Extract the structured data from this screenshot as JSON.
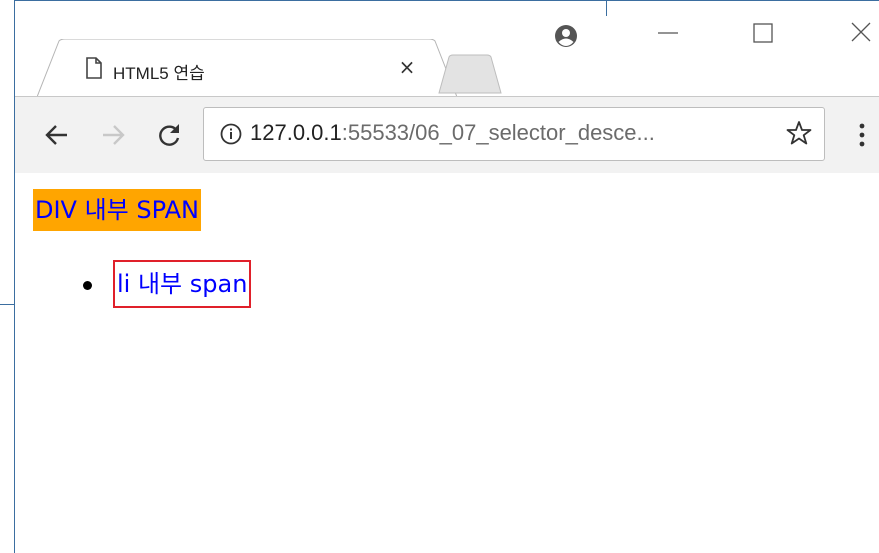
{
  "tab": {
    "title": "HTML5 연습",
    "close_label": "×",
    "page_icon": "page-icon"
  },
  "window_controls": {
    "profile": "profile-icon",
    "minimize": "minimize-icon",
    "maximize": "maximize-icon",
    "close": "close-icon"
  },
  "toolbar": {
    "back": "back-arrow-icon",
    "forward": "forward-arrow-icon",
    "reload": "reload-icon",
    "url_host": "127.0.0.1",
    "url_rest": ":55533/06_07_selector_desce...",
    "bookmark": "star-icon",
    "menu": "more-menu-icon"
  },
  "content": {
    "div_span_text": "DIV 내부 SPAN",
    "li_span_text": "li 내부 span"
  },
  "colors": {
    "div_span_bg": "#ffa500",
    "span_text": "#0000ff",
    "li_span_border": "#e0202a",
    "frame": "#3b6ea0"
  }
}
